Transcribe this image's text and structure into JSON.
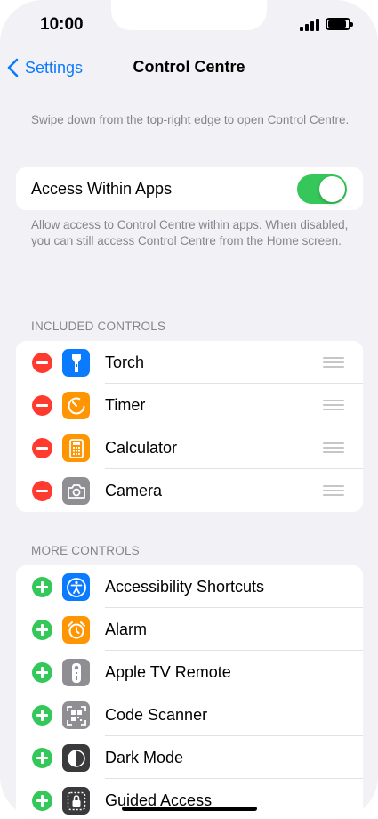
{
  "status": {
    "time": "10:00"
  },
  "nav": {
    "back_label": "Settings",
    "title": "Control Centre"
  },
  "intro_note": "Swipe down from the top-right edge to open Control Centre.",
  "access_within_apps": {
    "label": "Access Within Apps",
    "enabled": true,
    "note": "Allow access to Control Centre within apps. When disabled, you can still access Control Centre from the Home screen."
  },
  "included": {
    "header": "INCLUDED CONTROLS",
    "items": [
      {
        "label": "Torch",
        "icon": "torch-icon",
        "color": "#0a7aff"
      },
      {
        "label": "Timer",
        "icon": "timer-icon",
        "color": "#ff9500"
      },
      {
        "label": "Calculator",
        "icon": "calculator-icon",
        "color": "#ff9500"
      },
      {
        "label": "Camera",
        "icon": "camera-icon",
        "color": "#8e8e93"
      }
    ]
  },
  "more": {
    "header": "MORE CONTROLS",
    "items": [
      {
        "label": "Accessibility Shortcuts",
        "icon": "accessibility-icon",
        "color": "#0a7aff"
      },
      {
        "label": "Alarm",
        "icon": "alarm-icon",
        "color": "#ff9500"
      },
      {
        "label": "Apple TV Remote",
        "icon": "tv-remote-icon",
        "color": "#8e8e93"
      },
      {
        "label": "Code Scanner",
        "icon": "qr-code-icon",
        "color": "#8e8e93"
      },
      {
        "label": "Dark Mode",
        "icon": "dark-mode-icon",
        "color": "#3a3a3c"
      },
      {
        "label": "Guided Access",
        "icon": "lock-icon",
        "color": "#3a3a3c"
      }
    ]
  },
  "colors": {
    "accent": "#0a7aff",
    "toggle_on": "#35c759",
    "remove": "#ff3b30",
    "add": "#34c759",
    "background": "#f2f1f6"
  }
}
